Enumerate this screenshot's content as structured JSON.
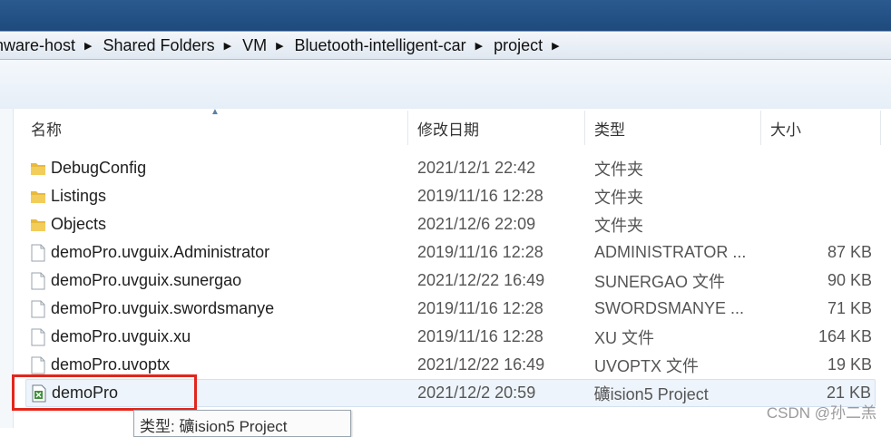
{
  "breadcrumb": [
    {
      "label": "nware-host"
    },
    {
      "label": "Shared Folders"
    },
    {
      "label": "VM"
    },
    {
      "label": "Bluetooth-intelligent-car"
    },
    {
      "label": "project"
    }
  ],
  "columns": {
    "name": "名称",
    "date": "修改日期",
    "type": "类型",
    "size": "大小"
  },
  "files": [
    {
      "icon": "folder-icon",
      "name": "DebugConfig",
      "date": "2021/12/1 22:42",
      "type": "文件夹",
      "size": ""
    },
    {
      "icon": "folder-icon",
      "name": "Listings",
      "date": "2019/11/16 12:28",
      "type": "文件夹",
      "size": ""
    },
    {
      "icon": "folder-icon",
      "name": "Objects",
      "date": "2021/12/6 22:09",
      "type": "文件夹",
      "size": ""
    },
    {
      "icon": "file-icon",
      "name": "demoPro.uvguix.Administrator",
      "date": "2019/11/16 12:28",
      "type": "ADMINISTRATOR ...",
      "size": "87 KB"
    },
    {
      "icon": "file-icon",
      "name": "demoPro.uvguix.sunergao",
      "date": "2021/12/22 16:49",
      "type": "SUNERGAO 文件",
      "size": "90 KB"
    },
    {
      "icon": "file-icon",
      "name": "demoPro.uvguix.swordsmanye",
      "date": "2019/11/16 12:28",
      "type": "SWORDSMANYE ...",
      "size": "71 KB"
    },
    {
      "icon": "file-icon",
      "name": "demoPro.uvguix.xu",
      "date": "2019/11/16 12:28",
      "type": "XU 文件",
      "size": "164 KB"
    },
    {
      "icon": "file-icon",
      "name": "demoPro.uvoptx",
      "date": "2021/12/22 16:49",
      "type": "UVOPTX 文件",
      "size": "19 KB"
    },
    {
      "icon": "uvision-project-icon",
      "name": "demoPro",
      "date": "2021/12/2 20:59",
      "type": "礦ision5 Project",
      "size": "21 KB"
    }
  ],
  "tooltip": "类型: 礦ision5 Project",
  "watermark": "CSDN @孙二羔",
  "colors": {
    "annotation_red": "#e2261c",
    "titlebar_blue": "#2b5a8f",
    "folder_yellow": "#e8b93c"
  }
}
